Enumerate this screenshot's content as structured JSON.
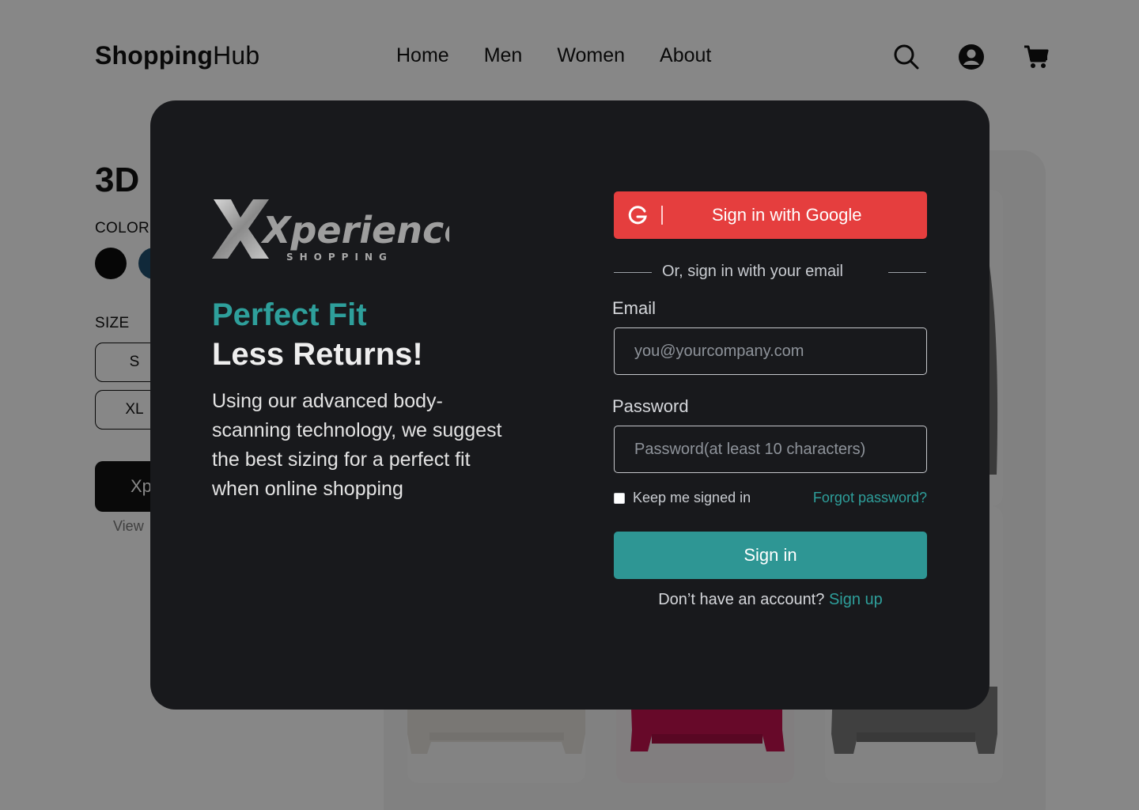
{
  "header": {
    "brand_bold": "Shopping",
    "brand_light": "Hub",
    "nav": [
      "Home",
      "Men",
      "Women",
      "About"
    ]
  },
  "product": {
    "title": "3D",
    "color_label": "COLOR",
    "size_label": "SIZE",
    "sizes": [
      "S",
      "XL"
    ],
    "xp_button_label": "Xp",
    "view_label": "View"
  },
  "modal": {
    "logo_text": "Xperience",
    "logo_subtext": "SHOPPING",
    "headline_1": "Perfect Fit",
    "headline_2": "Less Returns!",
    "description": "Using our advanced body-scanning technology, we suggest the best sizing for a perfect fit when online shopping",
    "google_button": "Sign in with Google",
    "divider_text": "Or, sign in with your email",
    "email_label": "Email",
    "email_placeholder": "you@yourcompany.com",
    "password_label": "Password",
    "password_placeholder": "Password(at least 10 characters)",
    "keep_signed_in": "Keep me signed in",
    "forgot_password": "Forgot password?",
    "sign_in_button": "Sign in",
    "no_account": "Don’t have an account?",
    "sign_up_link": "Sign up"
  },
  "colors": {
    "accent_teal": "#2e9f9b",
    "google_red": "#e53e3e",
    "modal_bg": "#18191c"
  }
}
